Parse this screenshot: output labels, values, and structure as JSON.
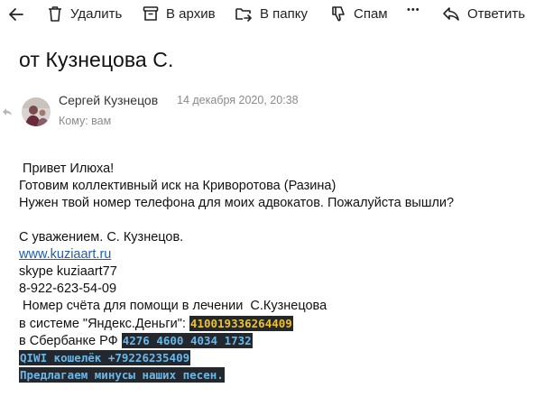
{
  "toolbar": {
    "back_icon": "arrow-left-icon",
    "delete_label": "Удалить",
    "archive_label": "В архив",
    "folder_label": "В папку",
    "spam_label": "Спам",
    "more_label": "•••",
    "reply_label": "Ответить"
  },
  "message": {
    "subject": "от Кузнецова С.",
    "sender_name": "Сергей Кузнецов",
    "date": "14 декабря 2020, 20:38",
    "to": "Кому: вам",
    "body": {
      "greeting": " Привет Илюха!",
      "line2": "Готовим коллективный иск на Криворотова (Разина)",
      "line3": "Нужен твой номер телефона для моих адвокатов. Пожалуйста вышли?",
      "signoff": "С уважением. С. Кузнецов.",
      "website": "www.kuziaart.ru",
      "skype": "skype kuziaart77",
      "phone": "8-922-623-54-09",
      "donation_intro": " Номер счёта для помощи в лечении  С.Кузнецова",
      "yandex_prefix": "в системе \"Яндекс.Деньги\": ",
      "yandex_account": "410019336264409",
      "sber_prefix": "в Сбербанке РФ ",
      "sber_card": "4276 4600 4034 1732",
      "qiwi": "QIWI кошелёк +79226235409",
      "songs": "Предлагаем минусы наших песен."
    }
  }
}
